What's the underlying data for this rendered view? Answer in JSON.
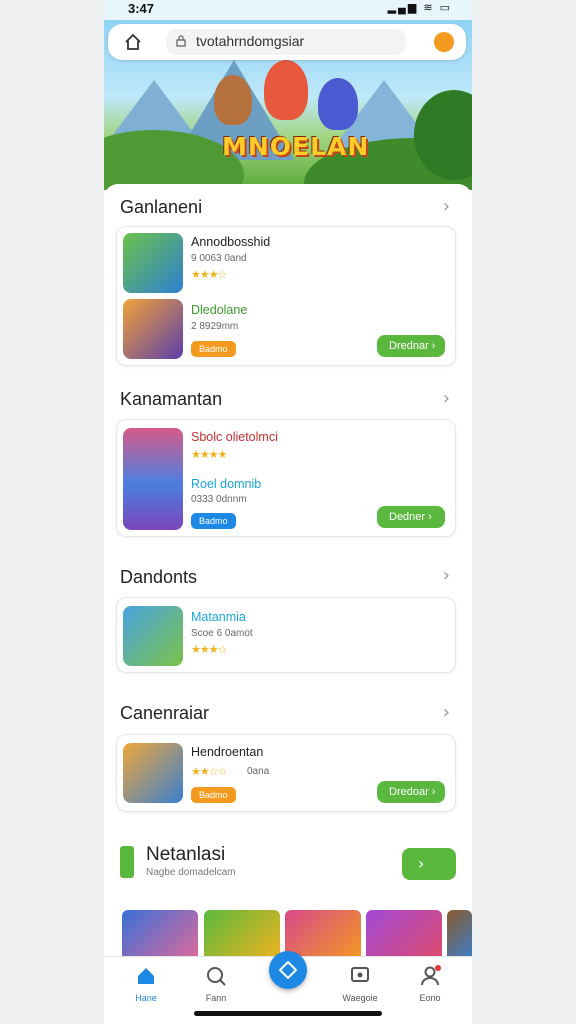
{
  "status": {
    "time": "3:47",
    "icons": "▂▄▆ ≋ ▭"
  },
  "browser": {
    "url": "tvotahrndomgsiar"
  },
  "hero": {
    "title": "MNOELAN"
  },
  "sections": [
    {
      "title": "Ganlaneni",
      "items": [
        {
          "name": "Annodbosshid",
          "sub": "9 0063 0and",
          "stars": "★★★☆"
        },
        {
          "name": "Dledolane",
          "sub": "2 8929mm",
          "pill": "Badmo",
          "button": "Drednar ›"
        }
      ]
    },
    {
      "title": "Kanamantan",
      "items": [
        {
          "name": "Sbolc olietolmci",
          "stars": "★★★★"
        },
        {
          "name": "Roel domnib",
          "sub": "0333 0dnnm",
          "pill": "Badmo",
          "button": "Dedner ›"
        }
      ]
    },
    {
      "title": "Dandonts",
      "items": [
        {
          "name": "Matanmia",
          "sub": "Scoe 6 0amot",
          "stars": "★★★☆"
        }
      ]
    },
    {
      "title": "Canenraiar",
      "items": [
        {
          "name": "Hendroentan",
          "sub": "0ana",
          "stars": "★★☆☆",
          "pill": "Badmo",
          "button": "Dredoar ›"
        }
      ]
    }
  ],
  "promo": {
    "title": "Netanlasi",
    "sub": "Nagbe domadelcam"
  },
  "tabs": [
    {
      "label": "Hane"
    },
    {
      "label": "Fann"
    },
    {
      "label": "Waegoie"
    },
    {
      "label": "Eono"
    }
  ],
  "colors": {
    "accent": "#1e88e5",
    "green": "#5bb83e",
    "orange": "#f49a1f"
  }
}
